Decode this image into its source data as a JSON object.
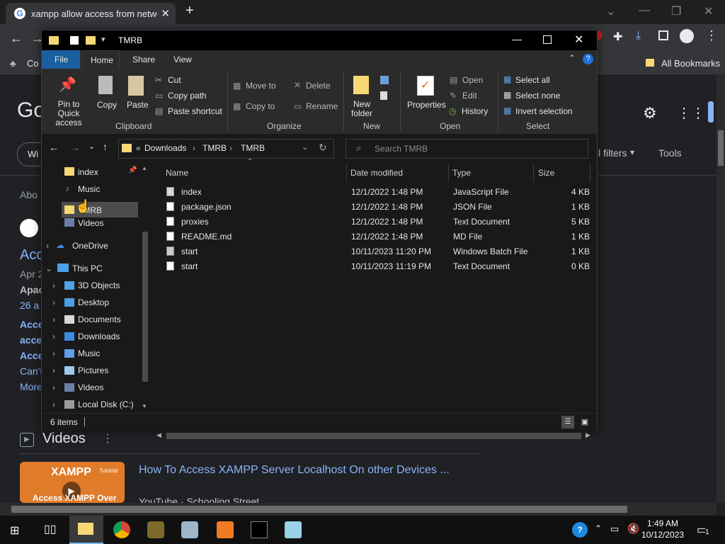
{
  "browser": {
    "tab_title": "xampp allow access from network",
    "bookmark_partial": "Co",
    "all_bookmarks": "All Bookmarks"
  },
  "google": {
    "logo_partial": "Go",
    "filter_partial": "Wi",
    "all_filters": "ll filters",
    "tools": "Tools",
    "about_partial": "Abo",
    "result_title_partial": "Acc",
    "date_partial": "Apr 2",
    "source_partial": "Apac",
    "count_partial": "26 a",
    "snippet": [
      "Acce",
      "acce",
      "Acce",
      "Can't",
      "More"
    ],
    "videos_heading": "Videos",
    "video_title": "How To Access XAMPP Server Localhost On other Devices ...",
    "video_source": "YouTube · Schooling Street",
    "thumb_logo": "XAMPP",
    "thumb_caption": "Access XAMPP Over",
    "thumb_tag": "Tutorial"
  },
  "explorer": {
    "window_title": "TMRB",
    "tabs": {
      "file": "File",
      "home": "Home",
      "share": "Share",
      "view": "View"
    },
    "ribbon": {
      "pin": "Pin to Quick access",
      "copy": "Copy",
      "paste": "Paste",
      "cut": "Cut",
      "copy_path": "Copy path",
      "paste_shortcut": "Paste shortcut",
      "move_to": "Move to",
      "copy_to": "Copy to",
      "delete": "Delete",
      "rename": "Rename",
      "new_folder": "New folder",
      "properties": "Properties",
      "open": "Open",
      "edit": "Edit",
      "history": "History",
      "select_all": "Select all",
      "select_none": "Select none",
      "invert_selection": "Invert selection",
      "groups": {
        "clipboard": "Clipboard",
        "organize": "Organize",
        "new": "New",
        "open": "Open",
        "select": "Select"
      }
    },
    "breadcrumb": {
      "overflow": "«",
      "items": [
        "Downloads",
        "TMRB",
        "TMRB"
      ]
    },
    "search_placeholder": "Search TMRB",
    "nav": {
      "quick_access": [
        {
          "label": "index",
          "icon": "folder-icon"
        },
        {
          "label": "Music",
          "icon": "music-icon"
        },
        {
          "label": "TMRB",
          "icon": "folder-icon"
        },
        {
          "label": "Videos",
          "icon": "videos-icon"
        }
      ],
      "onedrive": "OneDrive",
      "this_pc": "This PC",
      "pc_items": [
        {
          "label": "3D Objects",
          "icon": "3d-objects-icon"
        },
        {
          "label": "Desktop",
          "icon": "desktop-icon"
        },
        {
          "label": "Documents",
          "icon": "documents-icon"
        },
        {
          "label": "Downloads",
          "icon": "downloads-icon"
        },
        {
          "label": "Music",
          "icon": "music-icon"
        },
        {
          "label": "Pictures",
          "icon": "pictures-icon"
        },
        {
          "label": "Videos",
          "icon": "videos-icon"
        },
        {
          "label": "Local Disk (C:)",
          "icon": "disk-icon"
        }
      ]
    },
    "columns": {
      "name": "Name",
      "date": "Date modified",
      "type": "Type",
      "size": "Size"
    },
    "files": [
      {
        "name": "index",
        "date": "12/1/2022 1:48 PM",
        "type": "JavaScript File",
        "size": "4 KB",
        "icon": "js-file-icon"
      },
      {
        "name": "package.json",
        "date": "12/1/2022 1:48 PM",
        "type": "JSON File",
        "size": "1 KB",
        "icon": "file-icon"
      },
      {
        "name": "proxies",
        "date": "12/1/2022 1:48 PM",
        "type": "Text Document",
        "size": "5 KB",
        "icon": "text-file-icon"
      },
      {
        "name": "README.md",
        "date": "12/1/2022 1:48 PM",
        "type": "MD File",
        "size": "1 KB",
        "icon": "file-icon"
      },
      {
        "name": "start",
        "date": "10/11/2023 11:20 PM",
        "type": "Windows Batch File",
        "size": "1 KB",
        "icon": "batch-file-icon"
      },
      {
        "name": "start",
        "date": "10/11/2023 11:19 PM",
        "type": "Text Document",
        "size": "0 KB",
        "icon": "text-file-icon"
      }
    ],
    "status": "6 items"
  },
  "taskbar": {
    "time": "1:49 AM",
    "date": "10/12/2023",
    "notifications": "1"
  },
  "colors": {
    "accent_blue": "#8ab4f8",
    "folder_yellow": "#f8d775",
    "explorer_bg": "#191919",
    "ribbon_bg": "#2b2b2b",
    "selection": "#4d4d4d"
  }
}
